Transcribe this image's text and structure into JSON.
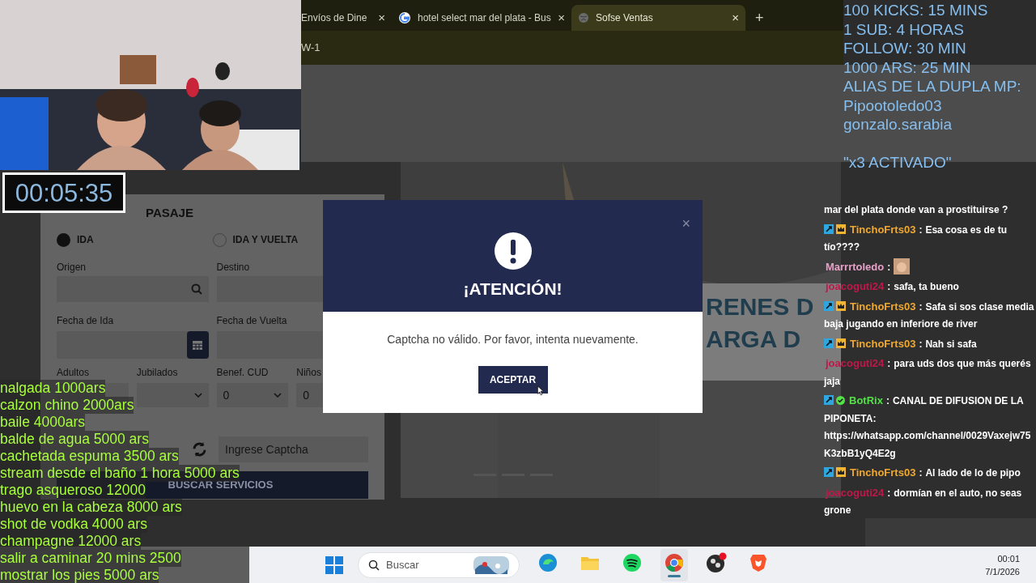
{
  "browser": {
    "tabs": [
      {
        "title": "Envíos de Dine",
        "selected": false,
        "kind": "cut"
      },
      {
        "title": "hotel select mar del plata - Bus",
        "selected": false,
        "kind": "google"
      },
      {
        "title": "Sofse Ventas",
        "selected": true,
        "kind": "page"
      }
    ],
    "new_tab": "+",
    "close": "×",
    "address": "W-1"
  },
  "form": {
    "title": "PASAJE",
    "trip_types": [
      {
        "label": "IDA",
        "selected": true
      },
      {
        "label": "IDA Y VUELTA",
        "selected": false
      }
    ],
    "origin_label": "Origen",
    "destination_label": "Destino",
    "departure_label": "Fecha de Ida",
    "return_label": "Fecha de Vuelta",
    "passengers": [
      {
        "label": "Adultos"
      },
      {
        "label": "Jubilados"
      },
      {
        "label": "Benef. CUD",
        "value": "0"
      },
      {
        "label": "Niños",
        "value": "0"
      }
    ],
    "captcha_placeholder": "Ingrese Captcha",
    "search_button": "BUSCAR SERVICIOS"
  },
  "hero": {
    "lines": [
      "RENES D",
      "ARGA D"
    ]
  },
  "dialog": {
    "title": "¡ATENCIÓN!",
    "message": "Captcha no válido. Por favor, intenta nuevamente.",
    "button": "ACEPTAR",
    "close": "×"
  },
  "timer": "00:05:35",
  "price_list": [
    "nalgada 1000ars",
    "calzon chino 2000ars",
    "baile 4000ars",
    "balde de agua 5000 ars",
    "cachetada espuma 3500 ars",
    "stream desde el baño 1 hora 5000 ars",
    "trago asqueroso 12000",
    "huevo en la cabeza 8000 ars",
    "shot de vodka 4000 ars",
    "champagne 12000 ars",
    "salir a caminar 20 mins 2500",
    "mostrar los pies 5000 ars"
  ],
  "goals": [
    "100 KICKS: 15 MINS",
    "1 SUB: 4 HORAS",
    "FOLLOW: 30 MIN",
    "1000 ARS: 25 MIN",
    "ALIAS DE LA DUPLA MP:",
    "Pipootoledo03",
    "gonzalo.sarabia"
  ],
  "goal_footer": "\"x3 ACTIVADO\"",
  "chat": [
    {
      "kind": "viewer",
      "text": "mar del plata donde van a prostituirse ?"
    },
    {
      "kind": "subscriber",
      "user": "TinchoFrts03",
      "color": "#f0a830",
      "separator": ":",
      "text": "Esa cosa es de tu tío????"
    },
    {
      "kind": "viewer",
      "user": "Marrrtoledo",
      "color": "#e8a0c8",
      "separator": ":",
      "emote": true
    },
    {
      "kind": "viewer",
      "user": "joacoguti24",
      "color": "#c0184a",
      "separator": ":",
      "text": "safa, ta bueno"
    },
    {
      "kind": "subscriber",
      "user": "TinchoFrts03",
      "color": "#f0a830",
      "separator": ":",
      "text": "Safa si sos clase media baja jugando en inferiore de river"
    },
    {
      "kind": "subscriber",
      "user": "TinchoFrts03",
      "color": "#f0a830",
      "separator": ":",
      "text": "Nah si safa"
    },
    {
      "kind": "viewer",
      "user": "joacoguti24",
      "color": "#c0184a",
      "separator": ":",
      "text": "para uds dos que más querés jaja"
    },
    {
      "kind": "bot",
      "user": "BotRix",
      "color": "#55e04a",
      "separator": ":",
      "text": "CANAL DE DIFUSION DE LA PIPONETA: https://whatsapp.com/channel/0029Vaxejw75K3zbB1yQ4E2g"
    },
    {
      "kind": "subscriber",
      "user": "TinchoFrts03",
      "color": "#f0a830",
      "separator": ":",
      "text": "Al lado de lo de pipo"
    },
    {
      "kind": "viewer",
      "user": "joacoguti24",
      "color": "#c0184a",
      "separator": ":",
      "text": "dormían en el auto, no seas grone"
    }
  ],
  "taskbar": {
    "search_placeholder": "Buscar",
    "apps": [
      {
        "kind": "edge",
        "selected": false
      },
      {
        "kind": "files",
        "selected": false
      },
      {
        "kind": "spotify",
        "selected": false
      },
      {
        "kind": "chrome",
        "selected": true
      },
      {
        "kind": "obs",
        "selected": false
      },
      {
        "kind": "brave",
        "selected": false
      }
    ],
    "time": "00:01",
    "date": "7/1/2026"
  }
}
